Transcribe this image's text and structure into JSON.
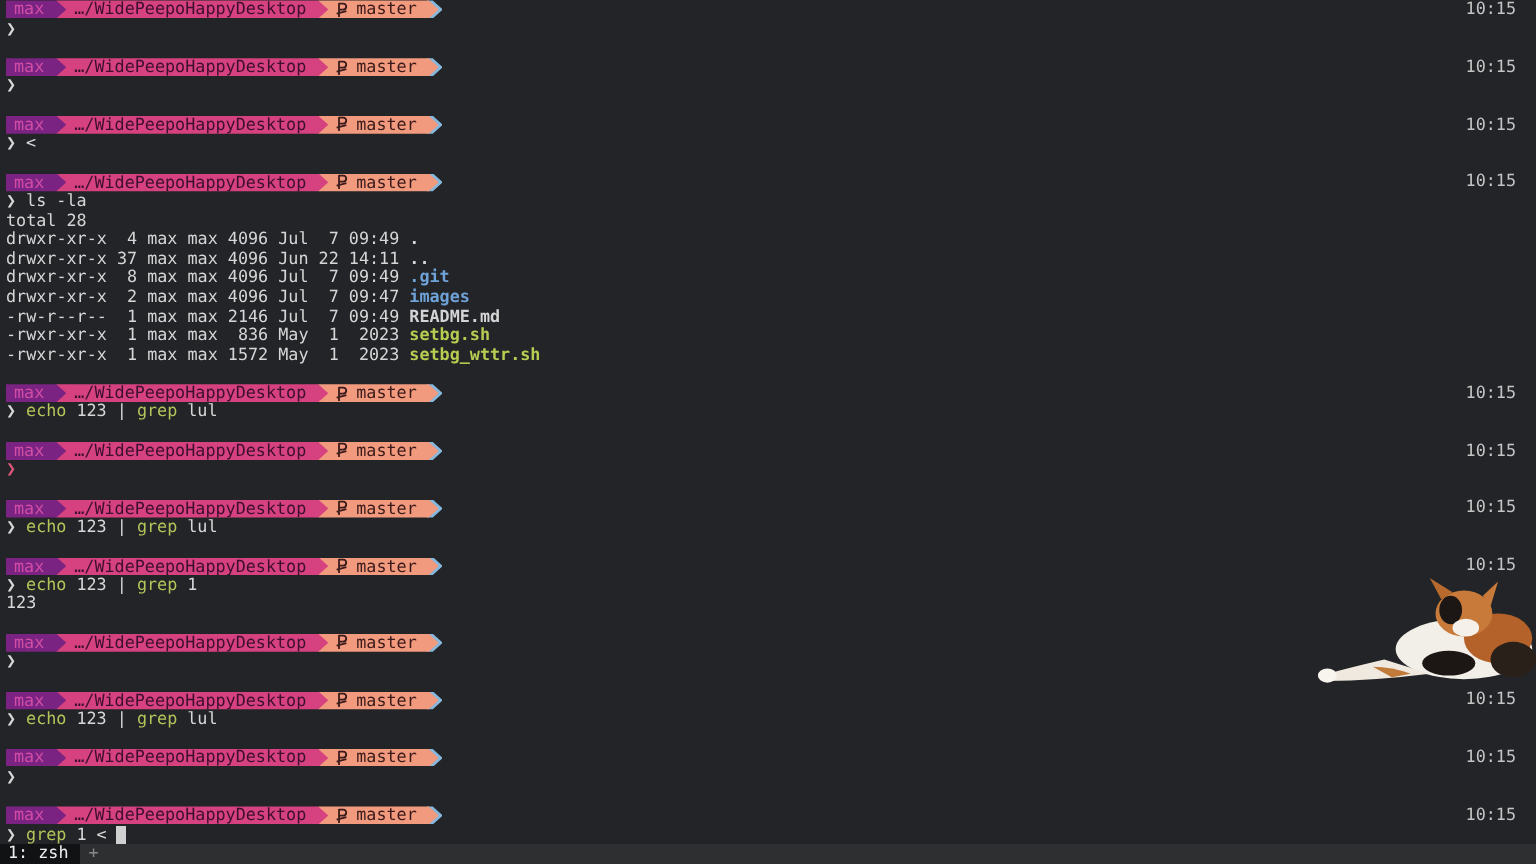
{
  "blocks": [
    {
      "prompt": {
        "user": "max",
        "path": "…/WidePeepoHappyDesktop",
        "branch": "master"
      },
      "time": "10:15",
      "symbol": "❯",
      "error": false
    },
    {
      "prompt": {
        "user": "max",
        "path": "…/WidePeepoHappyDesktop",
        "branch": "master"
      },
      "time": "10:15",
      "symbol": "❯",
      "error": false
    },
    {
      "prompt": {
        "user": "max",
        "path": "…/WidePeepoHappyDesktop",
        "branch": "master"
      },
      "time": "10:15",
      "symbol": "❯",
      "error": false,
      "command": [
        {
          "text": "<",
          "kind": "plain"
        }
      ]
    },
    {
      "prompt": {
        "user": "max",
        "path": "…/WidePeepoHappyDesktop",
        "branch": "master"
      },
      "time": "10:15",
      "symbol": "❯",
      "error": false,
      "command": [
        {
          "text": "ls -la",
          "kind": "plain"
        }
      ],
      "output": [
        {
          "text": "total 28"
        },
        {
          "text": "drwxr-xr-x  4 max max 4096 Jul  7 09:49",
          "file": ".",
          "color": "#d4d4d4"
        },
        {
          "text": "drwxr-xr-x 37 max max 4096 Jun 22 14:11",
          "file": "..",
          "color": "#d4d4d4"
        },
        {
          "text": "drwxr-xr-x  8 max max 4096 Jul  7 09:49",
          "file": ".git",
          "color": "#6fa3d8"
        },
        {
          "text": "drwxr-xr-x  2 max max 4096 Jul  7 09:47",
          "file": "images",
          "color": "#6fa3d8"
        },
        {
          "text": "-rw-r--r--  1 max max 2146 Jul  7 09:49",
          "file": "README.md",
          "color": "#d4d4d4"
        },
        {
          "text": "-rwxr-xr-x  1 max max  836 May  1  2023",
          "file": "setbg.sh",
          "color": "#b8cc52"
        },
        {
          "text": "-rwxr-xr-x  1 max max 1572 May  1  2023",
          "file": "setbg_wttr.sh",
          "color": "#b8cc52"
        }
      ]
    },
    {
      "prompt": {
        "user": "max",
        "path": "…/WidePeepoHappyDesktop",
        "branch": "master"
      },
      "time": "10:15",
      "symbol": "❯",
      "error": false,
      "command": [
        {
          "text": "echo",
          "kind": "command"
        },
        {
          "text": "123 |",
          "kind": "plain"
        },
        {
          "text": "grep",
          "kind": "command"
        },
        {
          "text": "lul",
          "kind": "plain"
        }
      ]
    },
    {
      "prompt": {
        "user": "max",
        "path": "…/WidePeepoHappyDesktop",
        "branch": "master"
      },
      "time": "10:15",
      "symbol": "❯",
      "error": true
    },
    {
      "prompt": {
        "user": "max",
        "path": "…/WidePeepoHappyDesktop",
        "branch": "master"
      },
      "time": "10:15",
      "symbol": "❯",
      "error": false,
      "command": [
        {
          "text": "echo",
          "kind": "command"
        },
        {
          "text": "123 |",
          "kind": "plain"
        },
        {
          "text": "grep",
          "kind": "command"
        },
        {
          "text": "lul",
          "kind": "plain"
        }
      ]
    },
    {
      "prompt": {
        "user": "max",
        "path": "…/WidePeepoHappyDesktop",
        "branch": "master"
      },
      "time": "10:15",
      "symbol": "❯",
      "error": false,
      "command": [
        {
          "text": "echo",
          "kind": "command"
        },
        {
          "text": "123 |",
          "kind": "plain"
        },
        {
          "text": "grep",
          "kind": "command"
        },
        {
          "text": "1",
          "kind": "plain"
        }
      ],
      "output": [
        {
          "text": "123"
        }
      ]
    },
    {
      "prompt": {
        "user": "max",
        "path": "…/WidePeepoHappyDesktop",
        "branch": "master"
      },
      "symbol": "❯",
      "error": false
    },
    {
      "prompt": {
        "user": "max",
        "path": "…/WidePeepoHappyDesktop",
        "branch": "master"
      },
      "time": "10:15",
      "symbol": "❯",
      "error": false,
      "command": [
        {
          "text": "echo",
          "kind": "command"
        },
        {
          "text": "123 |",
          "kind": "plain"
        },
        {
          "text": "grep",
          "kind": "command"
        },
        {
          "text": "lul",
          "kind": "plain"
        }
      ]
    },
    {
      "prompt": {
        "user": "max",
        "path": "…/WidePeepoHappyDesktop",
        "branch": "master"
      },
      "time": "10:15",
      "symbol": "❯",
      "error": false
    },
    {
      "prompt": {
        "user": "max",
        "path": "…/WidePeepoHappyDesktop",
        "branch": "master"
      },
      "time": "10:15",
      "symbol": "❯",
      "error": false,
      "command": [
        {
          "text": "grep",
          "kind": "command"
        },
        {
          "text": "1 <",
          "kind": "plain"
        }
      ],
      "cursor": true
    }
  ],
  "tmux": {
    "windows": [
      {
        "label": "1: zsh",
        "selected": true
      }
    ],
    "new_window": "+"
  }
}
